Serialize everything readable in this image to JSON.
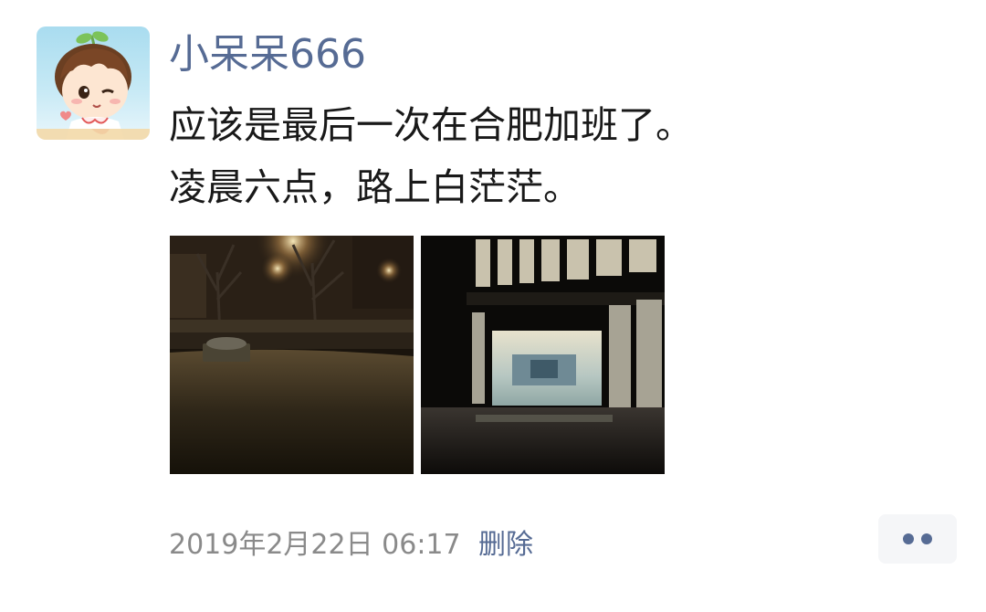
{
  "post": {
    "username": "小呆呆666",
    "text_lines": [
      "应该是最后一次在合肥加班了。",
      "凌晨六点，路上白茫茫。"
    ],
    "timestamp": "2019年2月22日 06:17",
    "delete_label": "删除",
    "photos": [
      {
        "icon": "night-snowy-street-photo"
      },
      {
        "icon": "lit-building-lobby-photo"
      }
    ]
  },
  "colors": {
    "username": "#566b94",
    "text": "#191919",
    "timestamp": "#8a8a8a",
    "link": "#566b94",
    "more_button_bg": "#f5f6f8"
  }
}
